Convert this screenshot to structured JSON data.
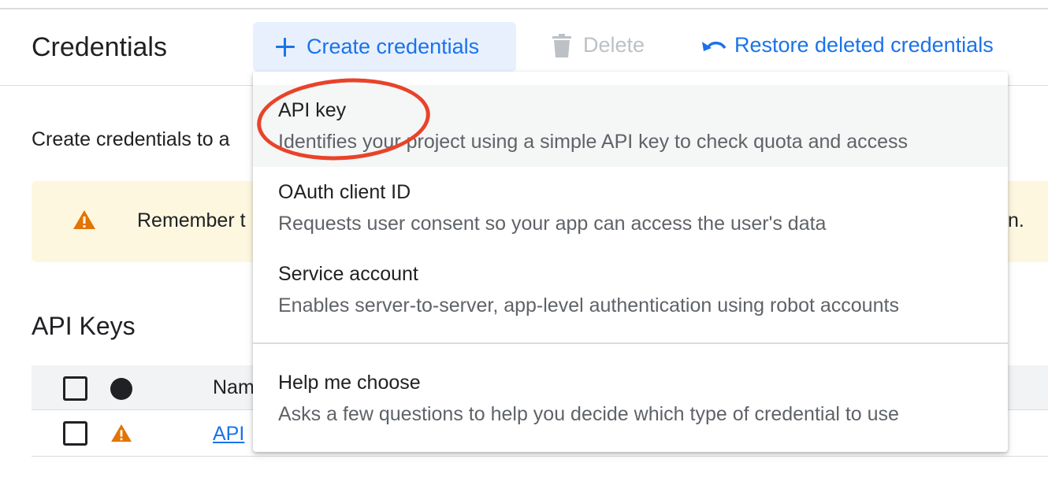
{
  "header": {
    "title": "Credentials",
    "create_label": "Create credentials",
    "delete_label": "Delete",
    "restore_label": "Restore deleted credentials"
  },
  "intro": {
    "text": "Create credentials to a"
  },
  "banner": {
    "text": "Remember t",
    "tail": "n."
  },
  "api_keys": {
    "title": "API Keys",
    "column_name": "Nam",
    "rows": [
      {
        "name": "API"
      }
    ]
  },
  "menu": {
    "items": [
      {
        "title": "API key",
        "description": "Identifies your project using a simple API key to check quota and access"
      },
      {
        "title": "OAuth client ID",
        "description": "Requests user consent so your app can access the user's data"
      },
      {
        "title": "Service account",
        "description": "Enables server-to-server, app-level authentication using robot accounts"
      },
      {
        "title": "Help me choose",
        "description": "Asks a few questions to help you decide which type of credential to use"
      }
    ]
  },
  "colors": {
    "accent": "#1a73e8",
    "warning": "#e37400",
    "annotation": "#e8432a",
    "banner_bg": "#fef7e0"
  },
  "icons": {
    "create": "plus-icon",
    "delete": "trash-icon",
    "restore": "undo-icon",
    "warning": "warning-icon"
  }
}
